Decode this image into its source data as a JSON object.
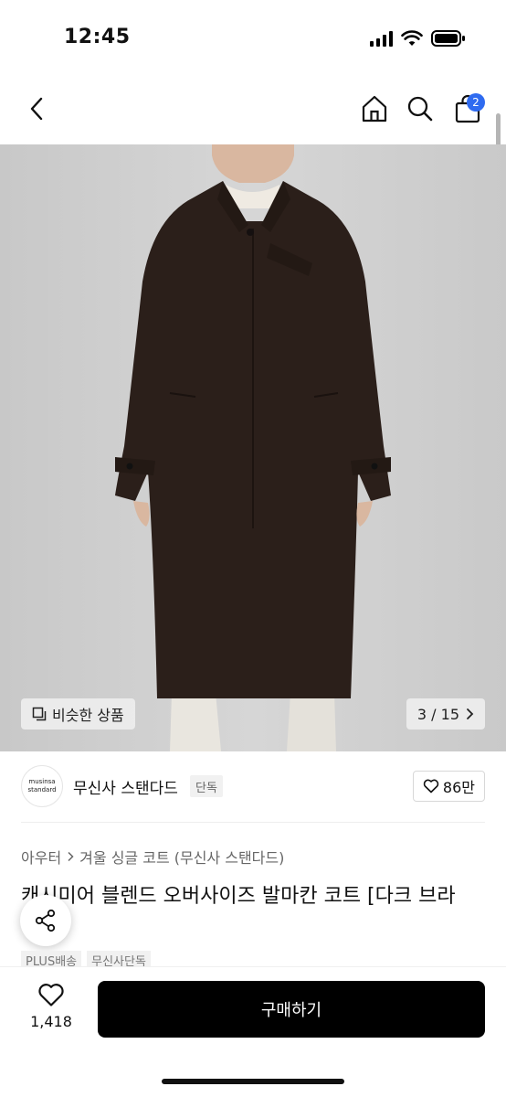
{
  "status_bar": {
    "time": "12:45"
  },
  "nav": {
    "back_icon": "chevron-left-icon",
    "home_icon": "home-icon",
    "search_icon": "search-icon",
    "cart_icon": "shopping-bag-icon",
    "cart_count": "2",
    "badge_color": "#2f6bf0"
  },
  "product_image": {
    "similar_label": "비슷한 상품",
    "page_counter": "3 / 15"
  },
  "brand": {
    "logo_text_line1": "musinsa",
    "logo_text_line2": "standard",
    "name": "무신사 스탠다드",
    "tag": "단독",
    "like_count": "86만"
  },
  "category": {
    "parent": "아우터",
    "child": "겨울 싱글 코트 (무신사 스탠다드)"
  },
  "product": {
    "title": "캐시미어 블렌드 오버사이즈 발마칸 코트 [다크 브라",
    "badges": [
      "PLUS배송",
      "무신사단독"
    ]
  },
  "bottom_bar": {
    "wish_count": "1,418",
    "buy_label": "구매하기",
    "buy_color": "#000000"
  }
}
